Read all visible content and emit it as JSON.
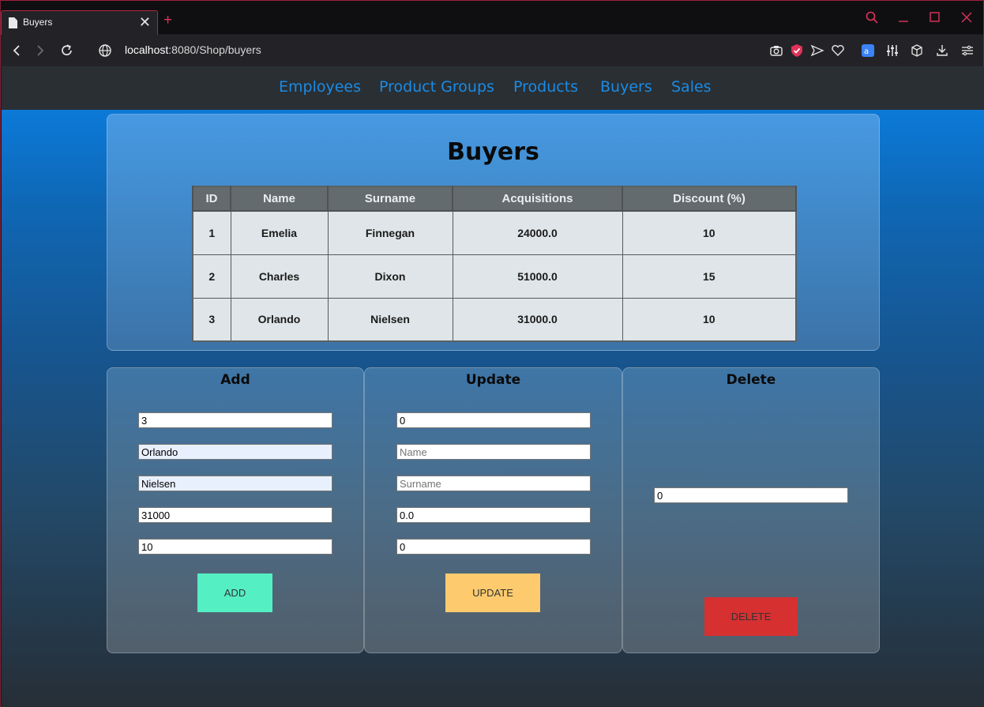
{
  "browser": {
    "tab_title": "Buyers",
    "tab_close": "✕",
    "new_tab": "+",
    "url_host": "localhost",
    "url_rest": ":8080/Shop/buyers"
  },
  "nav": {
    "items": [
      "Employees",
      "Product Groups",
      "Products",
      "Buyers",
      "Sales"
    ]
  },
  "main": {
    "title": "Buyers",
    "columns": [
      "ID",
      "Name",
      "Surname",
      "Acquisitions",
      "Discount (%)"
    ],
    "rows": [
      [
        "1",
        "Emelia",
        "Finnegan",
        "24000.0",
        "10"
      ],
      [
        "2",
        "Charles",
        "Dixon",
        "51000.0",
        "15"
      ],
      [
        "3",
        "Orlando",
        "Nielsen",
        "31000.0",
        "10"
      ]
    ]
  },
  "add": {
    "title": "Add",
    "id_value": "3",
    "name_value": "Orlando",
    "surname_value": "Nielsen",
    "acquisitions_value": "31000",
    "discount_value": "10",
    "button_label": "ADD"
  },
  "update": {
    "title": "Update",
    "id_value": "0",
    "name_placeholder": "Name",
    "surname_placeholder": "Surname",
    "acquisitions_value": "0.0",
    "discount_value": "0",
    "button_label": "UPDATE"
  },
  "delete": {
    "title": "Delete",
    "id_value": "0",
    "button_label": "DELETE"
  },
  "colors": {
    "add_button": "#55efc4",
    "update_button": "#fdcb6e",
    "delete_button": "#d63031",
    "nav_link": "#1a8be6",
    "accent": "#e0325a"
  }
}
